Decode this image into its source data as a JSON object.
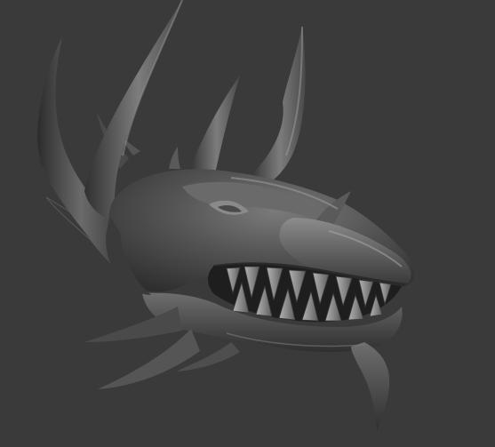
{
  "viewport": {
    "background": "#3a3a3a",
    "model_shades": {
      "base": "#4d4d4d",
      "dark": "#2a2a2a",
      "mid": "#5e5e5e",
      "light": "#8a8a8a",
      "highlight": "#a6a6a6"
    }
  }
}
